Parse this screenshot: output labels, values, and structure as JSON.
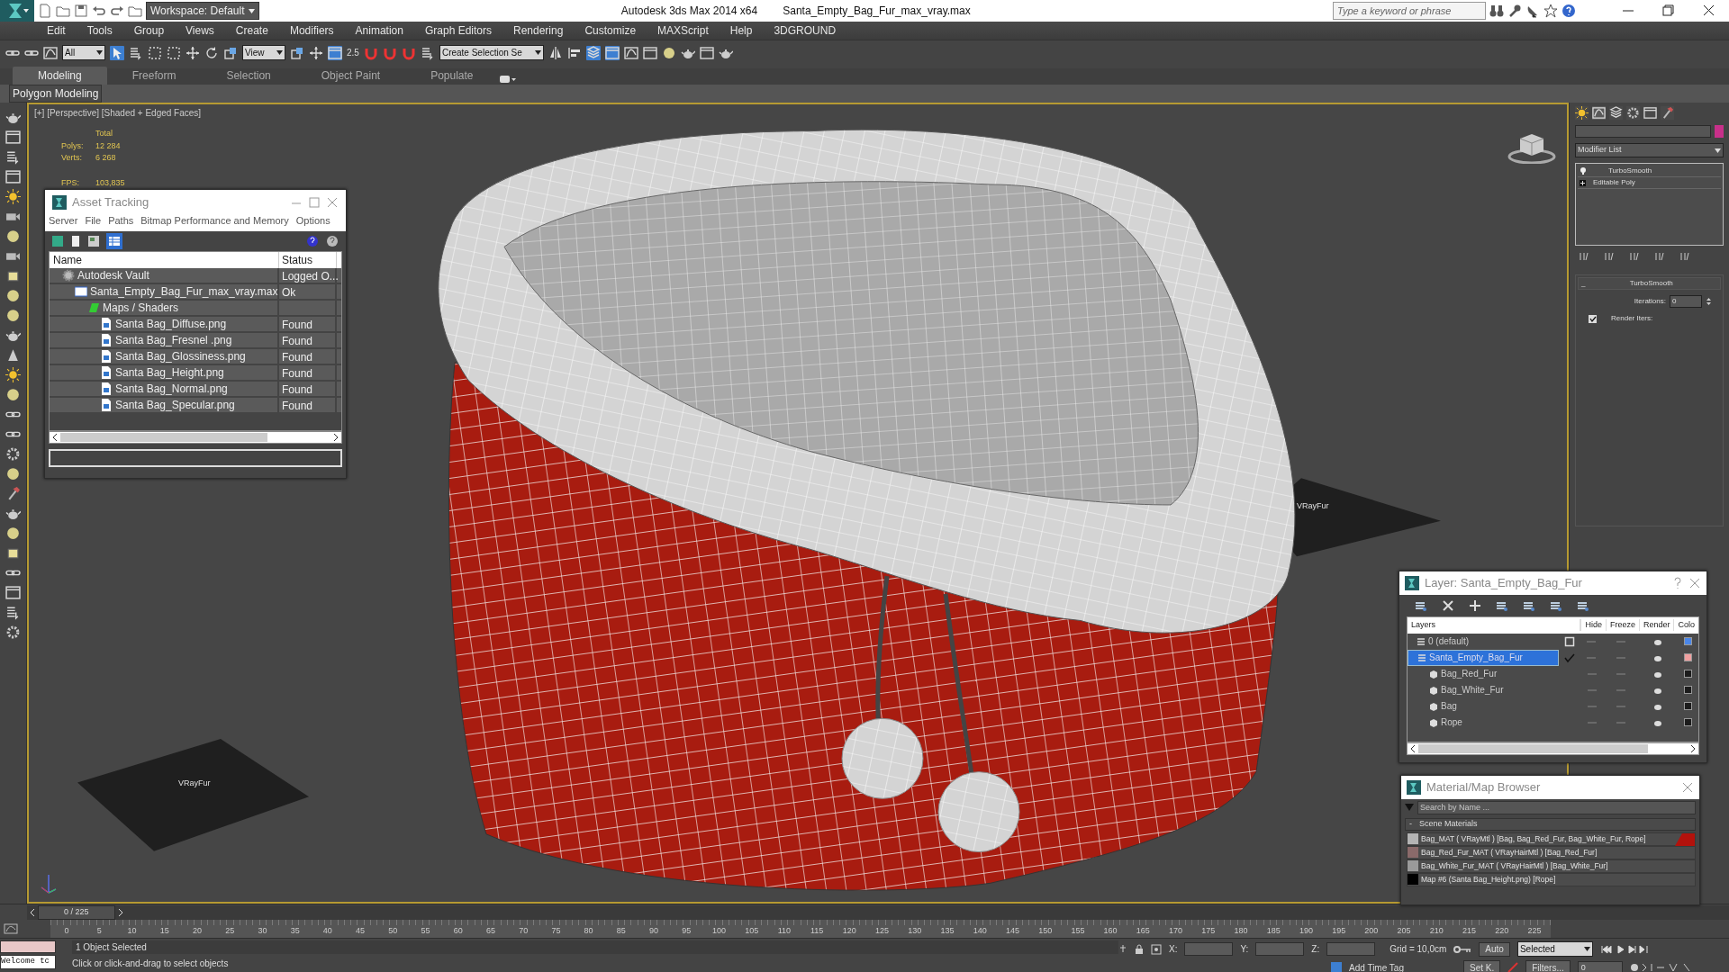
{
  "title_bar": {
    "workspace": "Workspace: Default",
    "title": "Autodesk 3ds Max  2014 x64",
    "file": "Santa_Empty_Bag_Fur_max_vray.max",
    "search_placeholder": "Type a keyword or phrase"
  },
  "menu": [
    "Edit",
    "Tools",
    "Group",
    "Views",
    "Create",
    "Modifiers",
    "Animation",
    "Graph Editors",
    "Rendering",
    "Customize",
    "MAXScript",
    "Help",
    "3DGROUND"
  ],
  "toolbar": {
    "selection_filter": "All",
    "reference_coord": "View",
    "snap_label": "2.5",
    "named_selection": "Create Selection Se"
  },
  "ribbon": {
    "tabs": [
      {
        "label": "Modeling",
        "selected": true
      },
      {
        "label": "Freeform",
        "selected": false
      },
      {
        "label": "Selection",
        "selected": false
      },
      {
        "label": "Object Paint",
        "selected": false
      },
      {
        "label": "Populate",
        "selected": false
      }
    ],
    "panel": "Polygon Modeling"
  },
  "viewport": {
    "label": "[+] [Perspective] [Shaded + Edged Faces]",
    "stats_heading": "Total",
    "stats": [
      {
        "label": "Polys:",
        "value": "12 284"
      },
      {
        "label": "Verts:",
        "value": "6 268"
      },
      {
        "label": "FPS:",
        "value": "103,835"
      }
    ],
    "helpers": [
      "VRayFur",
      "VRayFur"
    ]
  },
  "asset_tracking": {
    "title": "Asset Tracking",
    "menu": [
      "Server",
      "File",
      "Paths",
      "Bitmap Performance and Memory",
      "Options"
    ],
    "columns": [
      "Name",
      "Status"
    ],
    "rows": [
      {
        "kind": "vault",
        "name": "Autodesk Vault",
        "status": "Logged O...",
        "children": [
          {
            "kind": "scene",
            "name": "Santa_Empty_Bag_Fur_max_vray.max",
            "status": "Ok",
            "children": [
              {
                "kind": "folder",
                "name": "Maps / Shaders",
                "children": [
                  {
                    "kind": "bitmap",
                    "name": "Santa Bag_Diffuse.png",
                    "status": "Found"
                  },
                  {
                    "kind": "bitmap",
                    "name": "Santa Bag_Fresnel .png",
                    "status": "Found"
                  },
                  {
                    "kind": "bitmap",
                    "name": "Santa Bag_Glossiness.png",
                    "status": "Found"
                  },
                  {
                    "kind": "bitmap",
                    "name": "Santa Bag_Height.png",
                    "status": "Found"
                  },
                  {
                    "kind": "bitmap",
                    "name": "Santa Bag_Normal.png",
                    "status": "Found"
                  },
                  {
                    "kind": "bitmap",
                    "name": "Santa Bag_Specular.png",
                    "status": "Found"
                  }
                ]
              }
            ]
          }
        ]
      }
    ]
  },
  "layer_manager": {
    "title": "Layer: Santa_Empty_Bag_Fur",
    "columns": [
      "Layers",
      "Hide",
      "Freeze",
      "Render",
      "Colo"
    ],
    "layers": [
      {
        "name": "0 (default)",
        "selected": false,
        "current": false,
        "color": "#4a86e8"
      },
      {
        "name": "Santa_Empty_Bag_Fur",
        "selected": true,
        "current": true,
        "color": "#f0a0a0",
        "children": [
          {
            "name": "Bag_Red_Fur",
            "selected": false,
            "color": "#1c1c1c"
          },
          {
            "name": "Bag_White_Fur",
            "selected": false,
            "color": "#1c1c1c"
          },
          {
            "name": "Bag",
            "selected": false,
            "color": "#1c1c1c"
          },
          {
            "name": "Rope",
            "selected": false,
            "color": "#1c1c1c"
          }
        ]
      }
    ]
  },
  "material_browser": {
    "title": "Material/Map Browser",
    "search_placeholder": "Search by Name ...",
    "group_toggle": "-",
    "group": "Scene Materials",
    "materials": [
      {
        "name": "Bag_MAT  ( VRayMtl )  [Bag, Bag_Red_Fur, Bag_White_Fur, Rope]",
        "color": "#b4b4b4",
        "hot": true
      },
      {
        "name": "Bag_Red_Fur_MAT  ( VRayHairMtl )  [Bag_Red_Fur]",
        "color": "#8a6a6a",
        "hot": false
      },
      {
        "name": "Bag_White_Fur_MAT  ( VRayHairMtl )  [Bag_White_Fur]",
        "color": "#9a9a9a",
        "hot": false
      },
      {
        "name": "Map #6 (Santa Bag_Height.png)  [Rope]",
        "color": "#000000",
        "hot": false
      }
    ]
  },
  "command_panel": {
    "modifier_list": "Modifier List",
    "stack": [
      {
        "name": "TurboSmooth",
        "kind": "modifier"
      },
      {
        "name": "Editable Poly",
        "kind": "base"
      }
    ],
    "rollout_toggle": "_",
    "rollout": "TurboSmooth",
    "iterations_label": "Iterations:",
    "iterations": "0",
    "render_iters_label": "Render Iters:",
    "render_iters": true
  },
  "timeline": {
    "position": "0 / 225",
    "ticks": [
      "0",
      "5",
      "10",
      "15",
      "20",
      "25",
      "30",
      "35",
      "40",
      "45",
      "50",
      "55",
      "60",
      "65",
      "70",
      "75",
      "80",
      "85",
      "90",
      "95",
      "100",
      "105",
      "110",
      "115",
      "120",
      "125",
      "130",
      "135",
      "140",
      "145",
      "150",
      "155",
      "160",
      "165",
      "170",
      "175",
      "180",
      "185",
      "190",
      "195",
      "200",
      "205",
      "210",
      "215",
      "220",
      "225"
    ]
  },
  "status": {
    "listener": "Welcome tc",
    "selection": "1 Object Selected",
    "prompt": "Click or click-and-drag to select objects",
    "coords": [
      "X:",
      "Y:",
      "Z:"
    ],
    "grid": "Grid = 10,0cm",
    "add_time_tag": "Add Time Tag",
    "auto_key": "Auto",
    "key_filter": "Selected",
    "set_key": "Set K.",
    "filters": "Filters...",
    "frame": "0"
  }
}
